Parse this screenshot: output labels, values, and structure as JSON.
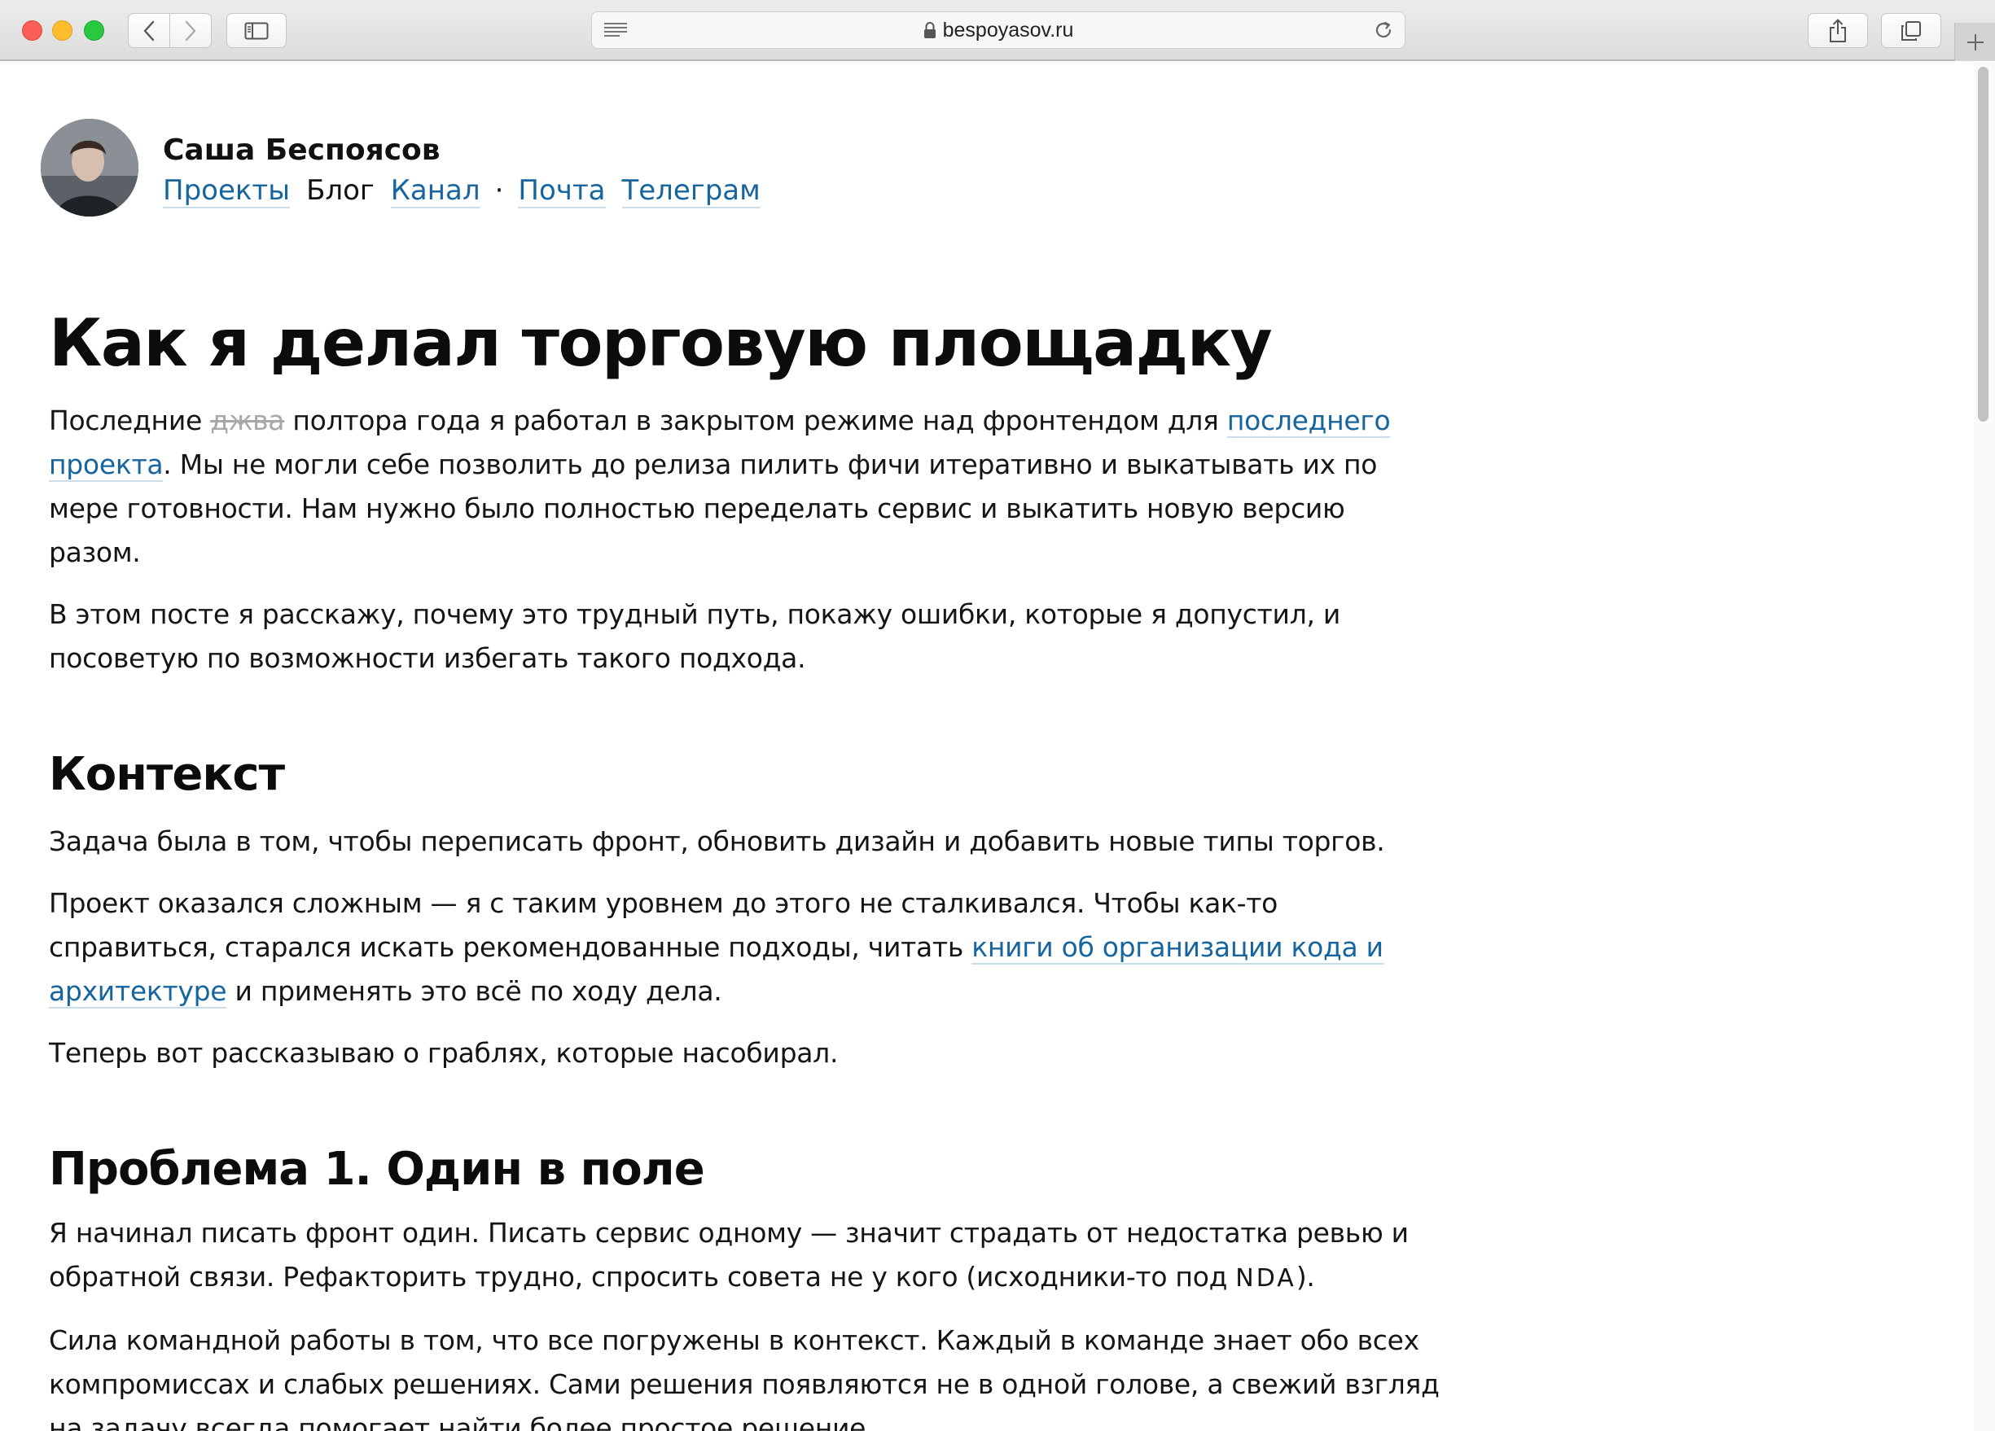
{
  "browser": {
    "url": "bespoyasov.ru"
  },
  "site": {
    "author": "Саша Беспоясов",
    "nav": {
      "projects": "Проекты",
      "blog": "Блог",
      "channel": "Канал",
      "separator": "·",
      "mail": "Почта",
      "telegram": "Телеграм"
    }
  },
  "article": {
    "title": "Как я делал торговую площадку",
    "intro_p1": {
      "before": "Последние ",
      "strike": "джва",
      "middle": " полтора года я работал в закрытом режиме над фронтендом для ",
      "link": "последнего проекта",
      "after": ". Мы не могли себе позволить до релиза пилить фичи итеративно и выкатывать их по мере готовности. Нам нужно было полностью переделать сервис и выкатить новую версию разом."
    },
    "intro_p2": "В этом посте я расскажу, почему это трудный путь, покажу ошибки, которые я допустил, и посоветую по возможности избегать такого подхода.",
    "context": {
      "heading": "Контекст",
      "p1": "Задача была в том, чтобы переписать фронт, обновить дизайн и добавить новые типы торгов.",
      "p2_before": "Проект оказался сложным — я с таким уровнем до этого не сталкивался. Чтобы как-то справиться, старался искать рекомендованные подходы, читать ",
      "p2_link": "книги об организации кода и архитектуре",
      "p2_after": " и применять это всё по ходу дела.",
      "p3": "Теперь вот рассказываю о граблях, которые насобирал."
    },
    "problem1": {
      "heading": "Проблема 1. Один в поле",
      "p1_before": "Я начинал писать фронт один. Писать сервис одному — значит страдать от недостатка ревью и обратной связи. Рефакторить трудно, спросить совета не у кого (исходники-то под ",
      "p1_caps": "NDA",
      "p1_after": ").",
      "p2": "Сила командной работы в том, что все погружены в контекст. Каждый в команде знает обо всех компромиссах и слабых решениях. Сами решения появляются не в одной голове, а свежий взгляд на задачу всегда помогает найти более простое решение."
    }
  }
}
